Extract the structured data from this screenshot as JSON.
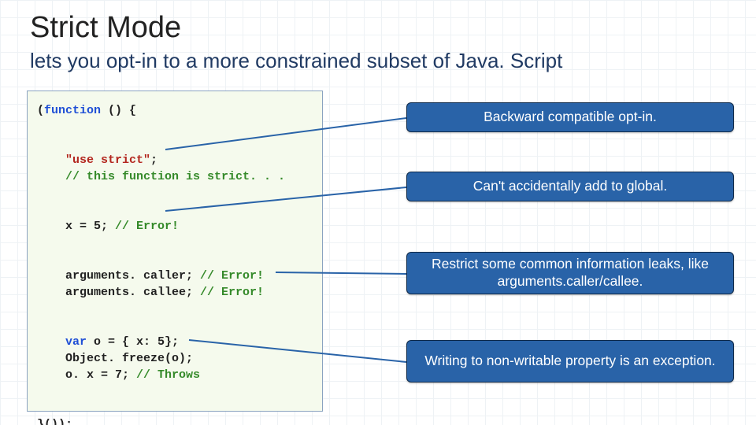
{
  "title": "Strict Mode",
  "subtitle": "lets you opt-in to a more constrained subset of Java. Script",
  "code": {
    "l1a": "(",
    "l1b": "function",
    "l1c": " () {",
    "l2a": "    ",
    "l2b": "\"use strict\"",
    "l2c": ";",
    "l3a": "    ",
    "l3b": "// this function is strict. . .",
    "l4a": "    x = 5; ",
    "l4b": "// Error!",
    "l5a": "    arguments. caller; ",
    "l5b": "// Error!",
    "l6a": "    arguments. callee; ",
    "l6b": "// Error!",
    "l7a": "    ",
    "l7b": "var",
    "l7c": " o = { x: 5};",
    "l8a": "    Object. freeze(o);",
    "l9a": "    o. x = 7; ",
    "l9b": "// Throws",
    "l10": "}());"
  },
  "callouts": {
    "c1": "Backward compatible opt-in.",
    "c2": "Can't accidentally add to global.",
    "c3": "Restrict some common information leaks, like arguments.caller/callee.",
    "c4": "Writing to non-writable property is an exception."
  },
  "colors": {
    "callout_bg": "#2963a8",
    "callout_border": "#0f2a4a",
    "code_bg": "#f5faed",
    "code_border": "#8aa3c0"
  }
}
